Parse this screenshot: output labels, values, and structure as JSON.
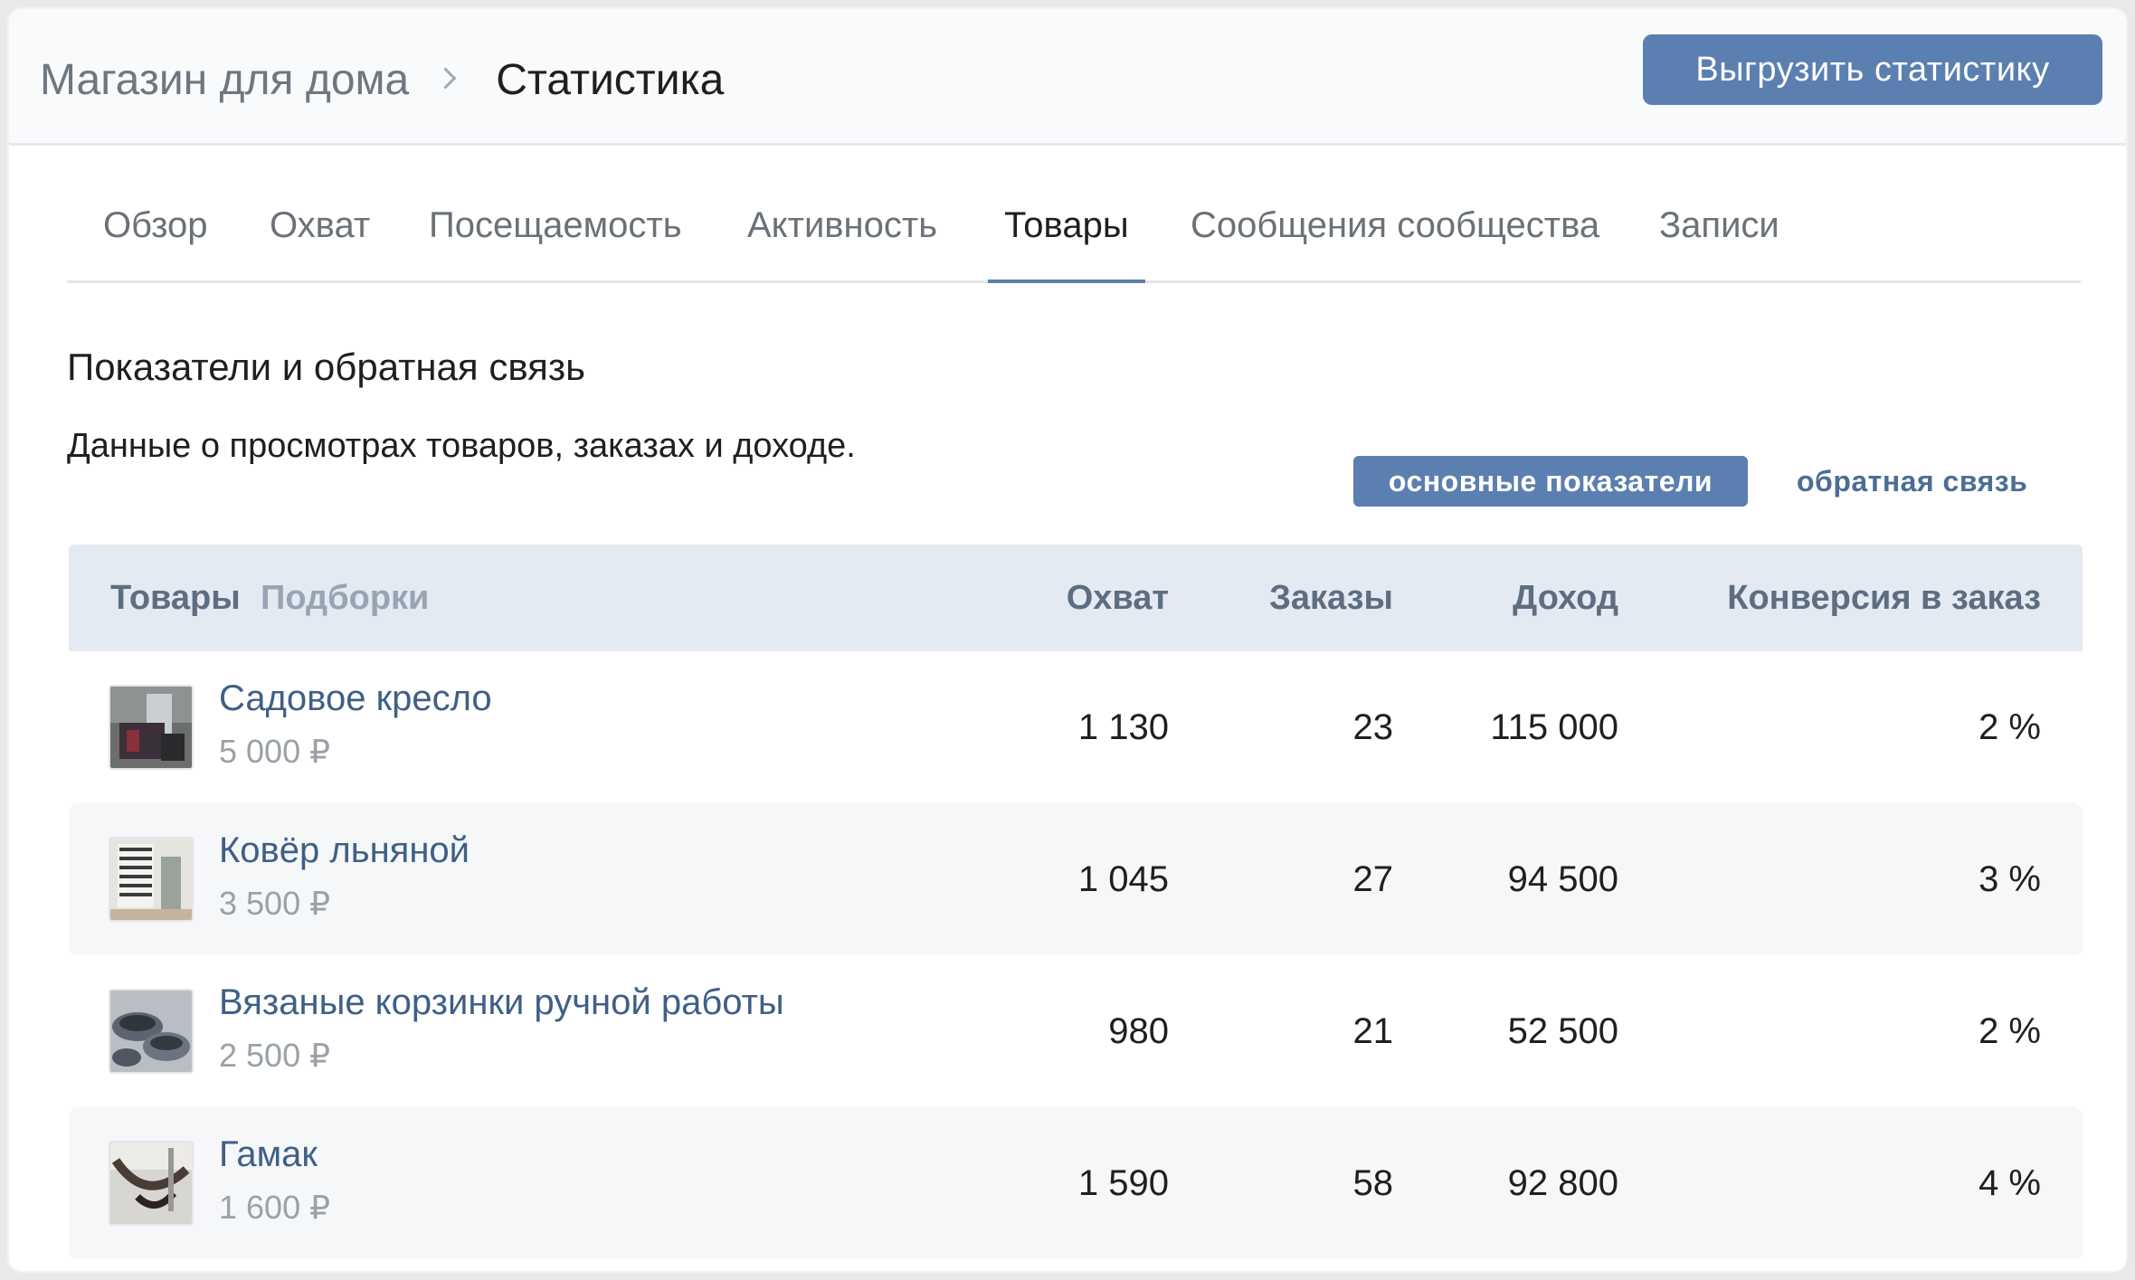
{
  "header": {
    "breadcrumb_root": "Магазин для дома",
    "breadcrumb_current": "Статистика",
    "export_button": "Выгрузить статистику"
  },
  "tabs": [
    {
      "label": "Обзор"
    },
    {
      "label": "Охват"
    },
    {
      "label": "Посещаемость"
    },
    {
      "label": "Активность"
    },
    {
      "label": "Товары",
      "active": true
    },
    {
      "label": "Сообщения сообщества"
    },
    {
      "label": "Записи"
    }
  ],
  "section": {
    "title": "Показатели и обратная связь",
    "description": "Данные о просмотрах товаров, заказах и доходе.",
    "toggle_active": "основные показатели",
    "toggle_inactive": "обратная связь"
  },
  "table": {
    "headers": {
      "products": "Товары",
      "collections": "Подборки",
      "reach": "Охват",
      "orders": "Заказы",
      "income": "Доход",
      "conversion": "Конверсия в заказ"
    },
    "rows": [
      {
        "name": "Садовое кресло",
        "price": "5 000 ₽",
        "reach": "1 130",
        "orders": "23",
        "income": "115 000",
        "conversion": "2 %"
      },
      {
        "name": "Ковёр льняной",
        "price": "3 500 ₽",
        "reach": "1 045",
        "orders": "27",
        "income": "94 500",
        "conversion": "3 %"
      },
      {
        "name": "Вязаные корзинки ручной работы",
        "price": "2 500 ₽",
        "reach": "980",
        "orders": "21",
        "income": "52 500",
        "conversion": "2 %"
      },
      {
        "name": "Гамак",
        "price": "1 600 ₽",
        "reach": "1 590",
        "orders": "58",
        "income": "92 800",
        "conversion": "4 %"
      }
    ]
  },
  "colors": {
    "accent": "#5b7fb0",
    "link": "#3f5f86",
    "table_header_bg": "#e4eaf2"
  }
}
